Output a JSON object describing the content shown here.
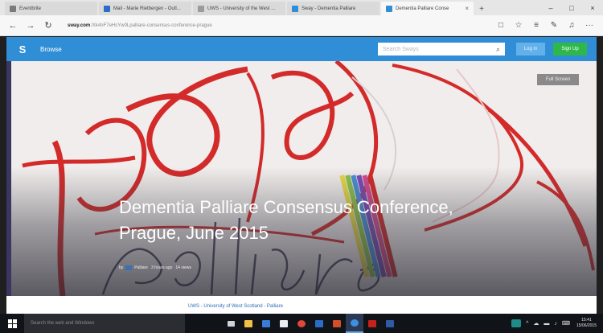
{
  "browser": {
    "tabs": [
      {
        "label": "Eventbrite",
        "favicon_color": "#7a7a7a",
        "active": false
      },
      {
        "label": "Mail - Marie Rietbergen - Outl...",
        "favicon_color": "#2b6cc4",
        "active": false
      },
      {
        "label": "UWS - University of the West ...",
        "favicon_color": "#9b9b9b",
        "active": false
      },
      {
        "label": "Sway - Dementia Palliare",
        "favicon_color": "#2f8ed6",
        "active": false
      },
      {
        "label": "Dementia Palliare Conse",
        "favicon_color": "#2f8ed6",
        "active": true
      }
    ],
    "tab_close": "×",
    "new_tab": "+",
    "window_controls": [
      "–",
      "□",
      "×"
    ],
    "url_domain": "sway.com",
    "url_path": "/Xk4nF7eHsYw0Lpalliare-consensus-conference-prague",
    "nav_icons": {
      "back": "←",
      "forward": "→",
      "refresh": "↻"
    },
    "right_icons": [
      "□",
      "☆",
      "≡",
      "✎",
      "♫",
      "···"
    ]
  },
  "sway_header": {
    "logo": "S",
    "browse_label": "Browse",
    "search_placeholder": "Search Sways",
    "search_icon": "magnifier",
    "login_label": "Log in",
    "signup_label": "Sign Up"
  },
  "hero": {
    "full_screen_label": "Full Screen",
    "title": "Dementia Palliare Consensus Conference, Prague, June 2015",
    "meta_by": "by",
    "meta_author": "Palliare",
    "meta_time": "3 hours ago",
    "meta_views": "14 views"
  },
  "page": {
    "link_text": "UWS - University of West Scotland - Palliare"
  },
  "taskbar": {
    "start_icon": "windows-logo",
    "search_placeholder": "Search the web and Windows",
    "apps": [
      {
        "name": "task-view",
        "color": "#cfd3da"
      },
      {
        "name": "explorer",
        "color": "#f2c044"
      },
      {
        "name": "store",
        "color": "#3a7bd5"
      },
      {
        "name": "mail",
        "color": "#e9eef5"
      },
      {
        "name": "chrome",
        "color": "#e0483b"
      },
      {
        "name": "outlook",
        "color": "#2b6cc4"
      },
      {
        "name": "powerpoint",
        "color": "#d34f2b"
      },
      {
        "name": "edge",
        "color": "#3d8fe0"
      },
      {
        "name": "acrobat",
        "color": "#c4221b"
      },
      {
        "name": "word",
        "color": "#2d5ba8"
      },
      {
        "name": "sway",
        "color": "#1e8a8a"
      }
    ],
    "tray_icons": [
      "^",
      "☁",
      "▬",
      "♪",
      "⌨"
    ],
    "clock_time": "15:41",
    "clock_date": "15/06/2015"
  },
  "colors": {
    "header_blue": "#2f8ed6",
    "signup_green": "#2fb84a",
    "brush_red": "#d32a2a",
    "title_text": "#ffffff"
  }
}
